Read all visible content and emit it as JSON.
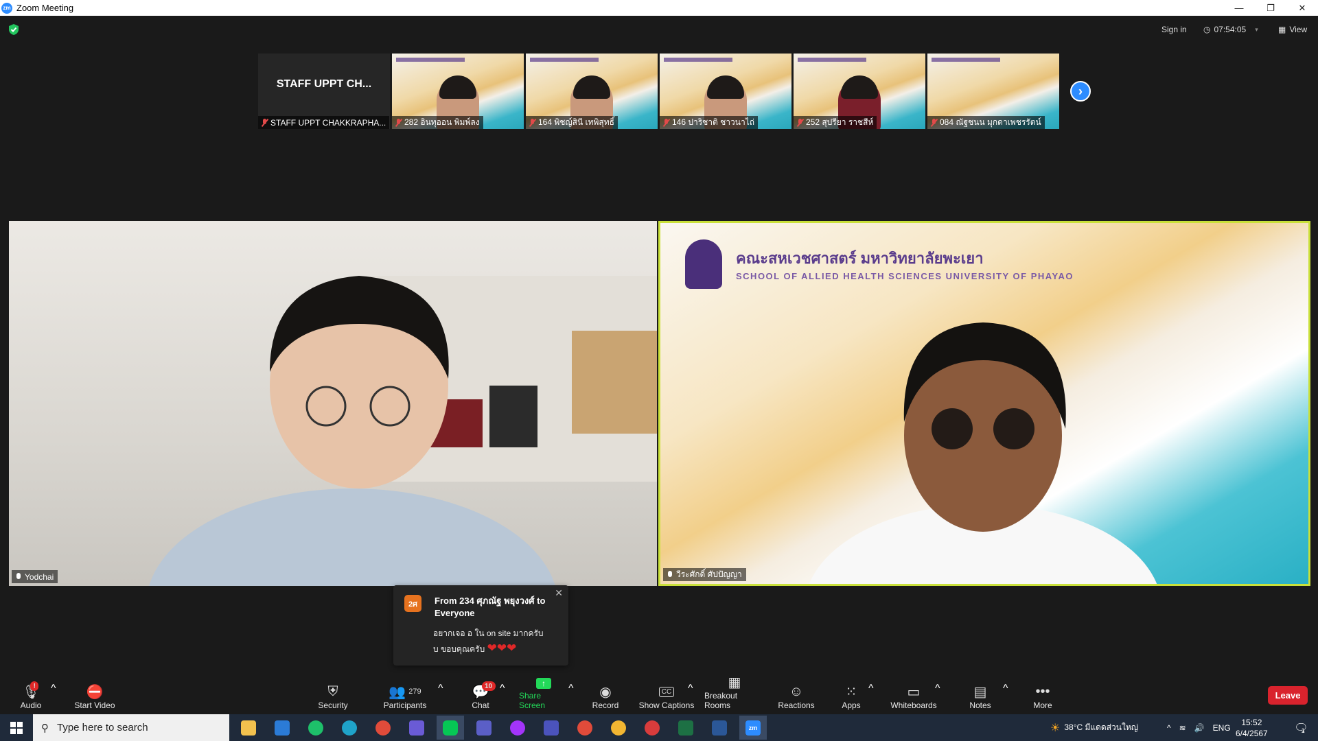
{
  "window": {
    "title": "Zoom Meeting",
    "app_logo": "zm"
  },
  "top": {
    "sign_in": "Sign in",
    "timer": "07:54:05",
    "view": "View"
  },
  "gallery": {
    "first_tile": {
      "big_name": "STAFF UPPT CH...",
      "label": "STAFF UPPT CHAKKRAPHA..."
    },
    "tiles": [
      {
        "label": "282 อินทุออน พิมพ์ลง"
      },
      {
        "label": "164 พิชญ์สินี เทพิสุทธิ์"
      },
      {
        "label": "146 ปาริชาติ ชาวนาไถ่"
      },
      {
        "label": "252 สุปรียา ราชสีห์"
      },
      {
        "label": "084 ณัฐชนน มุกดาเพชรรัตน์"
      }
    ]
  },
  "main": {
    "left_name": "Yodchai",
    "right_name": "วีระศักดิ์ ศัปปัญญา",
    "slide_title_th": "คณะสหเวชศาสตร์ มหาวิทยาลัยพะเยา",
    "slide_title_en": "SCHOOL OF ALLIED HEALTH SCIENCES UNIVERSITY OF PHAYAO"
  },
  "chat_popup": {
    "avatar": "2ศ",
    "from": "From 234 ศุภณัฐ พยุงวงศ์ to Everyone",
    "line1": "อยากเจอ อ ใน on site มากครับ",
    "line2": "บ ขอบคุณครับ"
  },
  "toolbar": {
    "audio": "Audio",
    "audio_badge": "!",
    "start_video": "Start Video",
    "security": "Security",
    "participants": "Participants",
    "participants_count": "279",
    "chat": "Chat",
    "chat_badge": "10",
    "share_screen": "Share Screen",
    "record": "Record",
    "show_captions": "Show Captions",
    "cc": "CC",
    "breakout_rooms": "Breakout Rooms",
    "reactions": "Reactions",
    "apps": "Apps",
    "whiteboards": "Whiteboards",
    "notes": "Notes",
    "more": "More",
    "leave": "Leave"
  },
  "taskbar": {
    "search_placeholder": "Type here to search",
    "weather": "38°C มีแดดส่วนใหญ่",
    "lang": "ENG",
    "time": "15:52",
    "date": "6/4/2567",
    "notif_count": "1",
    "zoom_label": "zm"
  },
  "colors": {
    "accent": "#2d8cff",
    "leave": "#d9232d",
    "speaker_border": "#c9e03a",
    "share": "#23d959"
  }
}
